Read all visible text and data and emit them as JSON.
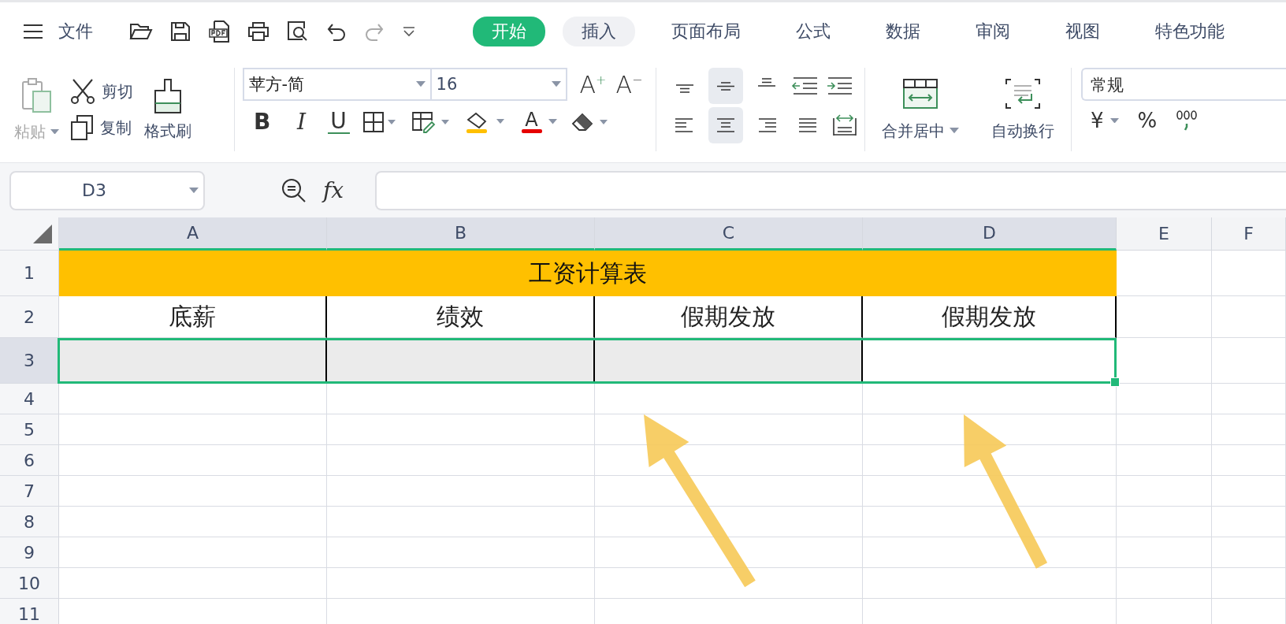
{
  "menu": {
    "file_label": "文件"
  },
  "tabs": [
    {
      "label": "开始",
      "selected": true
    },
    {
      "label": "插入",
      "selected": false
    },
    {
      "label": "页面布局",
      "selected": false
    },
    {
      "label": "公式",
      "selected": false
    },
    {
      "label": "数据",
      "selected": false
    },
    {
      "label": "审阅",
      "selected": false
    },
    {
      "label": "视图",
      "selected": false
    },
    {
      "label": "特色功能",
      "selected": false
    }
  ],
  "ribbon": {
    "paste": {
      "label": "粘贴",
      "disabled": true
    },
    "cut": "剪切",
    "copy": "复制",
    "format_painter": "格式刷",
    "font_name": "苹方-简",
    "font_size": "16",
    "bold": "B",
    "italic": "I",
    "underline": "U",
    "font_color": "A",
    "grow_font": "A$^{+}$",
    "shrink_font": "A$^{−}$",
    "vertical_align": [
      {
        "selected": false
      },
      {
        "selected": true
      },
      {
        "selected": false
      }
    ],
    "horizontal_align": [
      {
        "selected": false
      },
      {
        "selected": true
      },
      {
        "selected": false
      },
      {
        "selected": false
      }
    ],
    "merge": "合并居中",
    "wrap": "自动换行",
    "number_format": "常规",
    "currency": "¥",
    "percent": "%"
  },
  "formula_bar": {
    "name_box": "D3",
    "fx": "fx"
  },
  "sheet": {
    "columns": [
      {
        "label": "A",
        "selected": true
      },
      {
        "label": "B",
        "selected": true
      },
      {
        "label": "C",
        "selected": true
      },
      {
        "label": "D",
        "selected": true
      },
      {
        "label": "E",
        "selected": false
      },
      {
        "label": "F",
        "selected": false
      }
    ],
    "rows": [
      {
        "label": "1",
        "selected": false
      },
      {
        "label": "2",
        "selected": false
      },
      {
        "label": "3",
        "selected": true
      },
      {
        "label": "4",
        "selected": false
      },
      {
        "label": "5",
        "selected": false
      },
      {
        "label": "6",
        "selected": false
      },
      {
        "label": "7",
        "selected": false
      },
      {
        "label": "8",
        "selected": false
      },
      {
        "label": "9",
        "selected": false
      },
      {
        "label": "10",
        "selected": false
      },
      {
        "label": "11",
        "selected": false
      }
    ],
    "title": {
      "text": "工资计算表",
      "color": "#ffc000"
    },
    "headers": [
      "底薪",
      "绩效",
      "假期发放",
      "假期发放"
    ],
    "row_3": [
      {
        "active": false
      },
      {
        "active": false
      },
      {
        "active": false
      },
      {
        "active": true
      }
    ]
  }
}
